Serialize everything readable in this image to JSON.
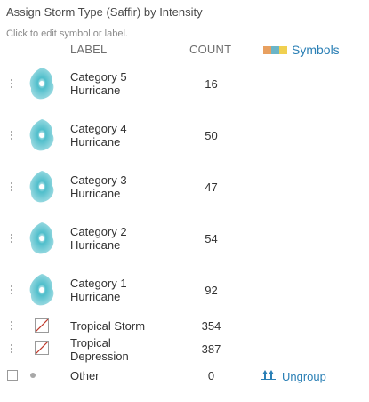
{
  "panel": {
    "title": "Assign Storm Type (Saffir) by Intensity",
    "hint": "Click to edit symbol or label."
  },
  "table": {
    "label_header": "LABEL",
    "count_header": "COUNT",
    "symbols_label": "Symbols",
    "symbols_swatch_colors": [
      "#e8a060",
      "#6ab5c8",
      "#f0d050"
    ],
    "rows": [
      {
        "label_line1": "Category 5",
        "label_line2": "Hurricane",
        "count": "16",
        "symbol": "hurricane-icon",
        "color": "#4fbecb"
      },
      {
        "label_line1": "Category 4",
        "label_line2": "Hurricane",
        "count": "50",
        "symbol": "hurricane-icon",
        "color": "#4fbecb"
      },
      {
        "label_line1": "Category 3",
        "label_line2": "Hurricane",
        "count": "47",
        "symbol": "hurricane-icon",
        "color": "#4fbecb"
      },
      {
        "label_line1": "Category 2",
        "label_line2": "Hurricane",
        "count": "54",
        "symbol": "hurricane-icon",
        "color": "#4fbecb"
      },
      {
        "label_line1": "Category 1",
        "label_line2": "Hurricane",
        "count": "92",
        "symbol": "hurricane-icon",
        "color": "#4fbecb"
      },
      {
        "label_line1": "Tropical Storm",
        "label_line2": "",
        "count": "354",
        "symbol": "no-symbol-icon"
      },
      {
        "label_line1": "Tropical",
        "label_line2": "Depression",
        "count": "387",
        "symbol": "no-symbol-icon"
      }
    ],
    "other": {
      "label": "Other",
      "count": "0",
      "ungroup_label": "Ungroup"
    }
  }
}
